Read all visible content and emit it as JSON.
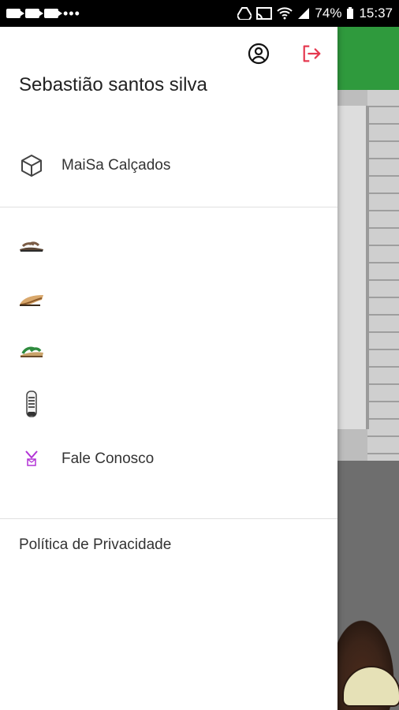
{
  "status_bar": {
    "battery": "74%",
    "time": "15:37"
  },
  "drawer": {
    "user_name": "Sebastião santos silva",
    "primary_item": {
      "label": "MaiSa Calçados",
      "icon": "cube-icon"
    },
    "categories": [
      {
        "icon": "sandal-brown-icon"
      },
      {
        "icon": "flat-shoe-beige-icon"
      },
      {
        "icon": "sandal-green-icon"
      },
      {
        "icon": "sneaker-white-icon"
      },
      {
        "label": "Fale Conosco",
        "icon": "contact-icon"
      }
    ],
    "privacy_label": "Política de Privacidade"
  },
  "colors": {
    "logout_accent": "#e53950",
    "app_green": "#2f9a3d"
  }
}
